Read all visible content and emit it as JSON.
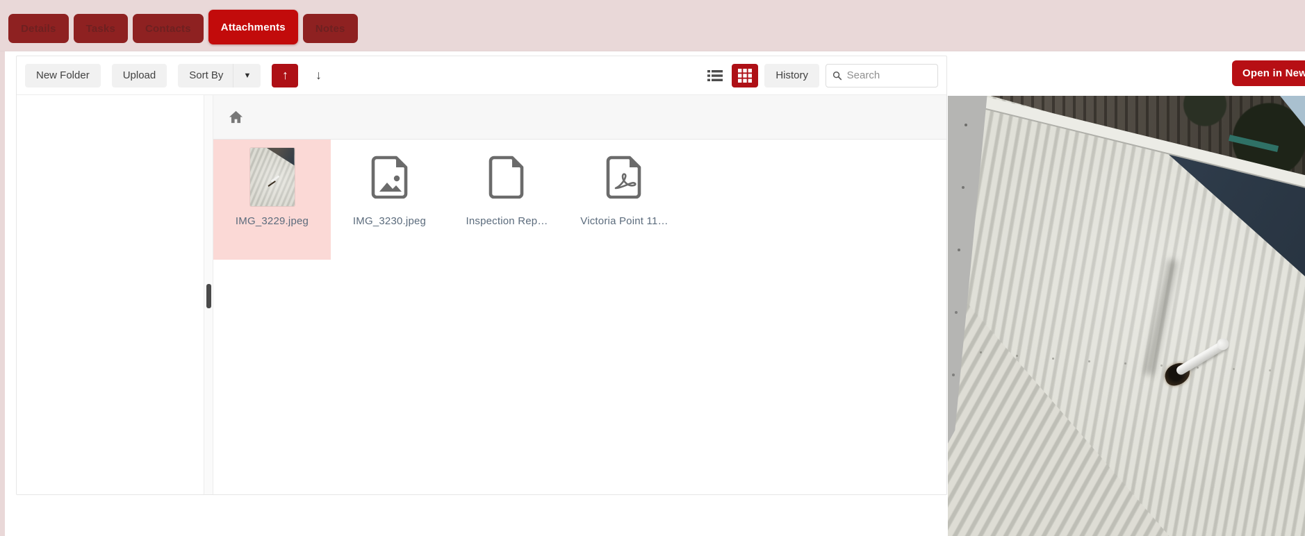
{
  "header": {
    "tabs": [
      {
        "label": "Details",
        "active": false
      },
      {
        "label": "Tasks",
        "active": false
      },
      {
        "label": "Contacts",
        "active": false
      },
      {
        "label": "Attachments",
        "active": true
      },
      {
        "label": "Notes",
        "active": false
      }
    ]
  },
  "toolbar": {
    "new_folder_label": "New Folder",
    "upload_label": "Upload",
    "sort_by_label": "Sort By",
    "sort_caret": "▼",
    "up_arrow": "↑",
    "down_arrow": "↓",
    "history_label": "History",
    "search_placeholder": "Search",
    "view_mode": "grid"
  },
  "breadcrumb": {
    "root": "home"
  },
  "files": [
    {
      "name": "IMG_3229.jpeg",
      "icon": "image-thumbnail",
      "selected": true
    },
    {
      "name": "IMG_3230.jpeg",
      "icon": "image-file-icon",
      "selected": false
    },
    {
      "name": "Inspection Rep…",
      "icon": "document-file-icon",
      "selected": false
    },
    {
      "name": "Victoria Point 11…",
      "icon": "pdf-file-icon",
      "selected": false
    }
  ],
  "preview": {
    "open_in_new_label": "Open in New",
    "description": "corrugated cream metal roof photo with white vent pipe and rust hole"
  },
  "colors": {
    "header_pink": "#e9d8d8",
    "active_tab_red": "#c20b0b",
    "inactive_tab_red": "#8e2121",
    "accent_red": "#ae1016",
    "selected_tile_pink": "#fbd9d6",
    "file_label": "#5b6b7c"
  }
}
